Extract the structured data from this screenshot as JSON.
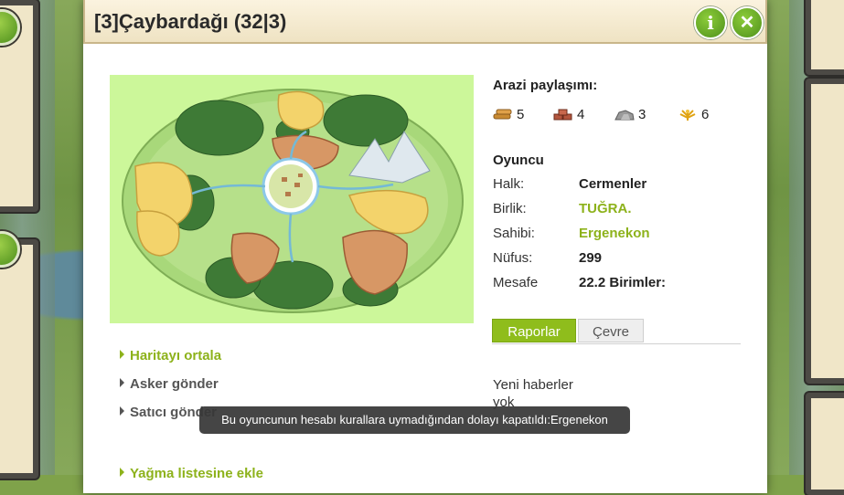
{
  "window": {
    "title": "[3]Çaybardağı (32|3)",
    "info_icon": "info-icon",
    "close_icon": "close-icon"
  },
  "land_distribution": {
    "title": "Arazi paylaşımı:",
    "resources": [
      {
        "icon": "wood-icon",
        "value": "5"
      },
      {
        "icon": "clay-icon",
        "value": "4"
      },
      {
        "icon": "iron-icon",
        "value": "3"
      },
      {
        "icon": "crop-icon",
        "value": "6"
      }
    ]
  },
  "player": {
    "title": "Oyuncu",
    "rows": [
      {
        "key": "Halk:",
        "value": "Cermenler"
      },
      {
        "key": "Birlik:",
        "value": "TUĞRA."
      },
      {
        "key": "Sahibi:",
        "value": "Ergenekon"
      },
      {
        "key": "Nüfus:",
        "value": "299"
      },
      {
        "key": "Mesafe",
        "value": "22.2 Birimler:"
      }
    ]
  },
  "tabs": [
    {
      "label": "Raporlar",
      "active": true
    },
    {
      "label": "Çevre",
      "active": false
    }
  ],
  "news": "Yeni haberler yok",
  "actions": [
    {
      "label": "Haritayı ortala"
    },
    {
      "label": "Asker gönder"
    },
    {
      "label": "Satıcı gönder"
    },
    {
      "label": "Yağma listesine ekle"
    }
  ],
  "tooltip": "Bu oyuncunun hesabı kurallara uymadığından dolayı kapatıldı:Ergenekon",
  "colors": {
    "accent_green": "#8db21b",
    "tab_active": "#8fbd1c",
    "map_bg": "#ccf79a",
    "title_bg": "#efe3c3"
  }
}
